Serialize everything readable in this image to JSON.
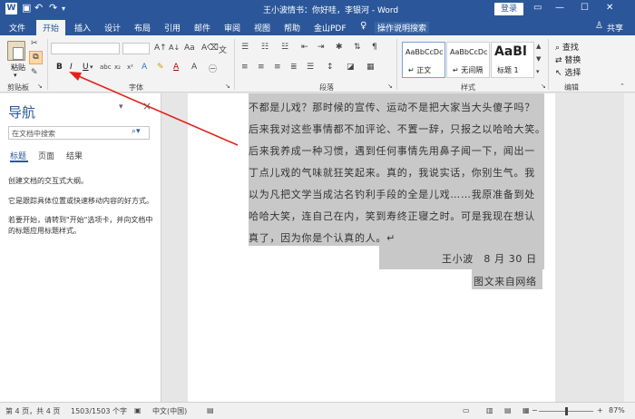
{
  "titlebar": {
    "app_letter": "W",
    "title": "王小波情书：你好哇，李银河 - Word",
    "login": "登录"
  },
  "tabs": [
    "文件",
    "开始",
    "插入",
    "设计",
    "布局",
    "引用",
    "邮件",
    "审阅",
    "视图",
    "帮助",
    "金山PDF"
  ],
  "active_tab": "开始",
  "tell_me": "操作说明搜索",
  "share": "共享",
  "ribbon": {
    "clipboard_label": "剪贴板",
    "paste_label": "粘贴",
    "font_label": "字体",
    "paragraph_label": "段落",
    "styles_label": "样式",
    "editing_label": "编辑",
    "bold": "B",
    "italic": "I",
    "underline": "U",
    "styles": [
      {
        "sample": "AaBbCcDc",
        "name": "↵ 正文"
      },
      {
        "sample": "AaBbCcDc",
        "name": "↵ 无间隔"
      },
      {
        "sample": "AaBl",
        "name": "标题 1"
      }
    ],
    "find": "查找",
    "replace": "替换",
    "select": "选择"
  },
  "nav": {
    "title": "导航",
    "search_placeholder": "在文档中搜索",
    "tabs": [
      "标题",
      "页面",
      "结果"
    ],
    "text1": "创建文档的交互式大纲。",
    "text2": "它是跟踪具体位置或快速移动内容的好方式。",
    "text3": "若要开始，请转到\"开始\"选项卡，并向文档中的标题应用标题样式。"
  },
  "document": {
    "lines": [
      "不都是儿戏？那时候的宣传、运动不是把大家当大头傻子吗？",
      "后来我对这些事情都不加评论、不置一辞，只报之以哈哈大笑。",
      "后来我养成一种习惯，遇到任何事情先用鼻子闻一下，闻出一",
      "丁点儿戏的气味就狂笑起来。真的，我说实话，你别生气。我",
      "以为凡把文学当成沽名钓利手段的全是儿戏……我原准备到处",
      "哈哈大笑，连自己在内，笑到寿终正寝之时。可是我现在想认",
      "真了，因为你是个认真的人。↵"
    ],
    "signature": "王小波　8 月 30 日",
    "note": "图文来自网络"
  },
  "status": {
    "page": "第 4 页，共 4 页",
    "words": "1503/1503 个字",
    "lang": "中文(中国)",
    "zoom": "87%"
  }
}
